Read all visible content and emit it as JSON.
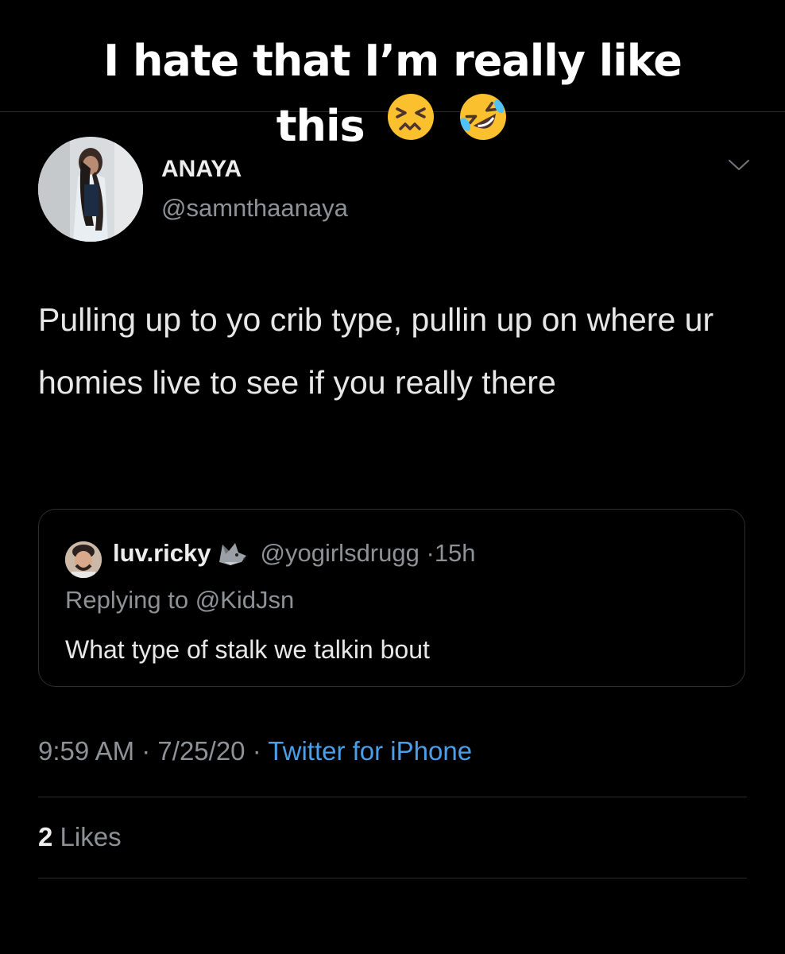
{
  "caption": {
    "line1": "I hate that I’m really like",
    "line2": "this",
    "emojis": [
      "confounded-face-emoji",
      "rolling-on-floor-laughing-emoji"
    ]
  },
  "tweet": {
    "display_name": "ANAYA",
    "handle": "@samnthaanaya",
    "text": "Pulling up to yo crib type, pullin up on where ur homies live to see if you really there",
    "time": "9:59 AM",
    "date": "7/25/20",
    "source": "Twitter for iPhone",
    "likes_count": "2",
    "likes_label": "Likes"
  },
  "quoted": {
    "display_name": "luv.ricky",
    "name_emoji": "wolf-emoji",
    "handle": "@yogirlsdrugg",
    "age": "15h",
    "replying_to": "Replying to @KidJsn",
    "text": "What type of stalk we talkin bout"
  },
  "colors": {
    "background": "#000000",
    "link": "#4a9fe8",
    "secondary_text": "#8e9296",
    "primary_text": "#e7e7e7"
  },
  "icons": [
    "chevron-down-icon"
  ]
}
